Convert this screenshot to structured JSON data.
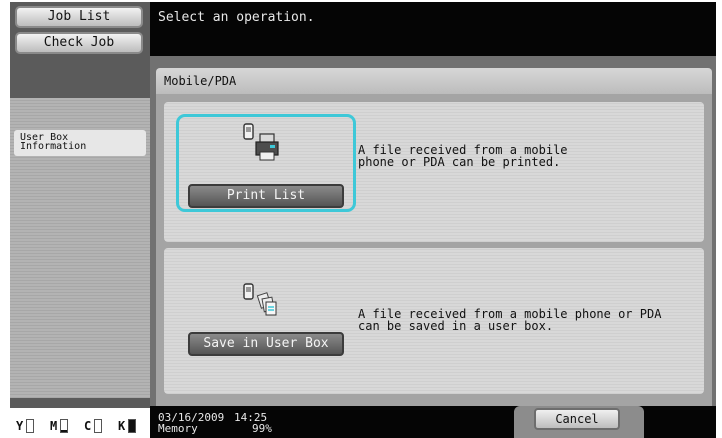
{
  "header": {
    "message": "Select an operation."
  },
  "sidebar": {
    "job_list_label": "Job List",
    "check_job_label": "Check Job",
    "user_box_info_label": "User Box Information"
  },
  "panel": {
    "title": "Mobile/PDA"
  },
  "options": [
    {
      "button_label": "Print List",
      "description": "A file received from a mobile\nphone or PDA can be printed.",
      "icon": "mobile-print-icon",
      "selected": true
    },
    {
      "button_label": "Save in User Box",
      "description": "A file received from a mobile phone or PDA\ncan be saved in a user box.",
      "icon": "mobile-save-icon",
      "selected": false
    }
  ],
  "footer": {
    "date": "03/16/2009",
    "time": "14:25",
    "memory_label": "Memory",
    "memory_value": "99%",
    "cancel_label": "Cancel"
  },
  "toner": [
    {
      "letter": "Y",
      "level": 0.0
    },
    {
      "letter": "M",
      "level": 0.2
    },
    {
      "letter": "C",
      "level": 0.0
    },
    {
      "letter": "K",
      "level": 1.0
    }
  ],
  "colors": {
    "highlight": "#3ec8d8",
    "header_bg": "#050505",
    "sidebar_bg": "#5b5b5b"
  }
}
